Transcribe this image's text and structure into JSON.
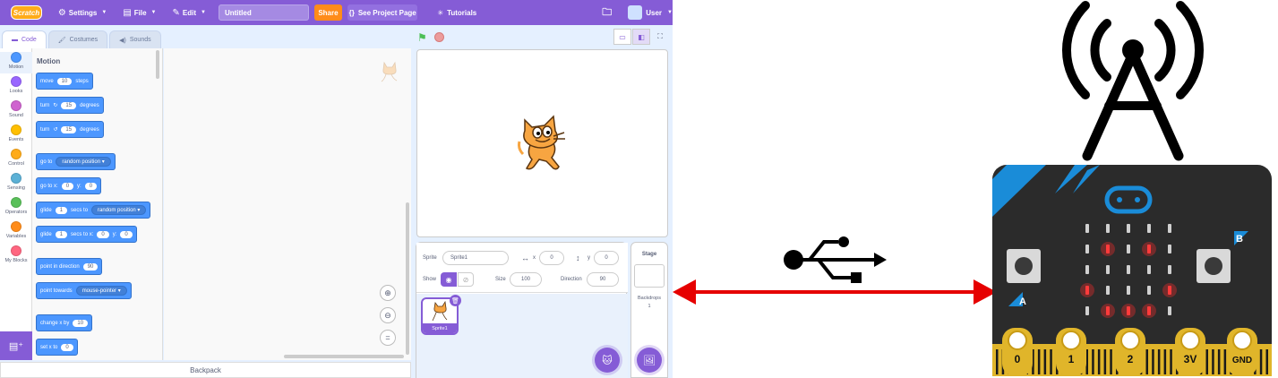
{
  "menubar": {
    "logo": "Scratch",
    "settings": "Settings",
    "file": "File",
    "edit": "Edit",
    "project_title": "Untitled",
    "share": "Share",
    "see_project": "See Project Page",
    "tutorials": "Tutorials",
    "user": "User"
  },
  "tabs": {
    "code": "Code",
    "costumes": "Costumes",
    "sounds": "Sounds"
  },
  "categories": [
    {
      "label": "Motion",
      "color": "#4c97ff"
    },
    {
      "label": "Looks",
      "color": "#9966ff"
    },
    {
      "label": "Sound",
      "color": "#cf63cf"
    },
    {
      "label": "Events",
      "color": "#ffbf00"
    },
    {
      "label": "Control",
      "color": "#ffab19"
    },
    {
      "label": "Sensing",
      "color": "#5cb1d6"
    },
    {
      "label": "Operators",
      "color": "#59c059"
    },
    {
      "label": "Variables",
      "color": "#ff8c1a"
    },
    {
      "label": "My Blocks",
      "color": "#ff6680"
    }
  ],
  "palette": {
    "title": "Motion",
    "move": {
      "a": "move",
      "v": "10",
      "b": "steps"
    },
    "turn_right": {
      "a": "turn",
      "v": "15",
      "b": "degrees"
    },
    "turn_left": {
      "a": "turn",
      "v": "15",
      "b": "degrees"
    },
    "goto": {
      "a": "go to",
      "dd": "random position"
    },
    "gotoxy": {
      "a": "go to x:",
      "x": "0",
      "b": "y:",
      "y": "0"
    },
    "glide_to": {
      "a": "glide",
      "v": "1",
      "b": "secs to",
      "dd": "random position"
    },
    "glide_xy": {
      "a": "glide",
      "v": "1",
      "b": "secs to x:",
      "x": "0",
      "c": "y:",
      "y": "0"
    },
    "point_dir": {
      "a": "point in direction",
      "v": "90"
    },
    "point_towards": {
      "a": "point towards",
      "dd": "mouse-pointer"
    },
    "change_x": {
      "a": "change x by",
      "v": "10"
    },
    "set_x": {
      "a": "set x to",
      "v": "0"
    }
  },
  "backpack": "Backpack",
  "sprite_info": {
    "sprite_label": "Sprite",
    "sprite_name": "Sprite1",
    "x_label": "x",
    "x_value": "0",
    "y_label": "y",
    "y_value": "0",
    "show_label": "Show",
    "size_label": "Size",
    "size_value": "100",
    "direction_label": "Direction",
    "direction_value": "90"
  },
  "sprites": [
    {
      "name": "Sprite1"
    }
  ],
  "stage_pane": {
    "title": "Stage",
    "backdrops_label": "Backdrops",
    "backdrops_count": "1"
  },
  "microbit": {
    "button_a": "A",
    "button_b": "B",
    "pins": [
      "0",
      "1",
      "2",
      "3V",
      "GND"
    ],
    "led_matrix": [
      [
        0,
        0,
        0,
        0,
        0
      ],
      [
        0,
        1,
        0,
        1,
        0
      ],
      [
        0,
        0,
        0,
        0,
        0
      ],
      [
        1,
        0,
        0,
        0,
        1
      ],
      [
        0,
        1,
        1,
        1,
        0
      ]
    ]
  },
  "colors": {
    "scratch_purple": "#855cd6",
    "motion_blue": "#4c97ff",
    "arrow_red": "#e60000",
    "microbit_board": "#2b2b2b",
    "microbit_accent": "#1a8cd8",
    "pin_gold": "#e0b52a"
  }
}
